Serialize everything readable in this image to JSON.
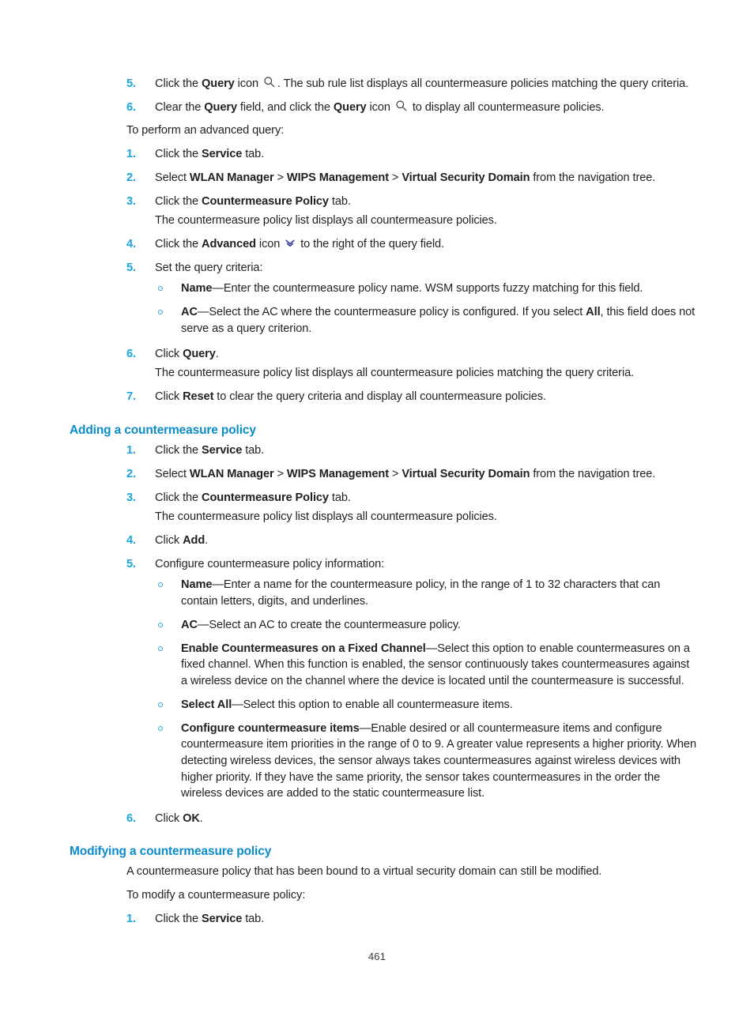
{
  "page": {
    "number": "461",
    "heading_color": "#0c8ccb",
    "list_number_color": "#18a5e0",
    "bullet_color": "#2aa8e0",
    "text_color": "#231f20"
  },
  "icons": {
    "query": "search-icon",
    "advanced": "double-chevron-down-icon"
  },
  "block_query_steps": {
    "items": [
      {
        "num": "5.",
        "pre": "Click the ",
        "bold1": "Query",
        "mid": " icon ",
        "icon": "search-icon",
        "post": ". The sub rule list displays all countermeasure policies matching the query criteria."
      },
      {
        "num": "6.",
        "pre": "Clear the ",
        "bold1": "Query",
        "mid": " field, and click the ",
        "bold2": "Query",
        "mid2": " icon ",
        "icon": "search-icon",
        "post": " to display all countermeasure policies."
      }
    ]
  },
  "advanced_query": {
    "lead": "To perform an advanced query:",
    "steps": [
      {
        "num": "1.",
        "pre": "Click the ",
        "bold": "Service",
        "post": " tab."
      },
      {
        "num": "2.",
        "pre": "Select ",
        "bold1": "WLAN Manager",
        "sep1": " > ",
        "bold2": "WIPS Management",
        "sep2": " > ",
        "bold3": "Virtual Security Domain",
        "post": " from the navigation tree."
      },
      {
        "num": "3.",
        "pre": "Click the ",
        "bold": "Countermeasure Policy",
        "post": " tab.",
        "subpara": "The countermeasure policy list displays all countermeasure policies."
      },
      {
        "num": "4.",
        "pre": "Click the ",
        "bold": "Advanced",
        "mid": " icon ",
        "icon": "double-chevron-down-icon",
        "post": " to the right of the query field."
      },
      {
        "num": "5.",
        "text": "Set the query criteria:",
        "subs": [
          {
            "bold": "Name",
            "dash": "—",
            "text": "Enter the countermeasure policy name. WSM supports fuzzy matching for this field."
          },
          {
            "bold": "AC",
            "dash": "—",
            "text_before": "Select the AC where the countermeasure policy is configured. If you select ",
            "bold_inline": "All",
            "text_after": ", this field does not serve as a query criterion."
          }
        ]
      },
      {
        "num": "6.",
        "pre": "Click ",
        "bold": "Query",
        "post": ".",
        "subpara": "The countermeasure policy list displays all countermeasure policies matching the query criteria."
      },
      {
        "num": "7.",
        "pre": "Click ",
        "bold": "Reset",
        "post": " to clear the query criteria and display all countermeasure policies."
      }
    ]
  },
  "adding_section": {
    "heading": "Adding a countermeasure policy",
    "steps": [
      {
        "num": "1.",
        "pre": "Click the ",
        "bold": "Service",
        "post": " tab."
      },
      {
        "num": "2.",
        "pre": "Select ",
        "bold1": "WLAN Manager",
        "sep1": " > ",
        "bold2": "WIPS Management",
        "sep2": " > ",
        "bold3": "Virtual Security Domain",
        "post": " from the navigation tree."
      },
      {
        "num": "3.",
        "pre": "Click the ",
        "bold": "Countermeasure Policy",
        "post": " tab.",
        "subpara": "The countermeasure policy list displays all countermeasure policies."
      },
      {
        "num": "4.",
        "pre": "Click ",
        "bold": "Add",
        "post": "."
      },
      {
        "num": "5.",
        "text": "Configure countermeasure policy information:",
        "subs": [
          {
            "bold": "Name",
            "dash": "—",
            "text": "Enter a name for the countermeasure policy, in the range of 1 to 32 characters that can contain letters, digits, and underlines."
          },
          {
            "bold": "AC",
            "dash": "—",
            "text": "Select an AC to create the countermeasure policy."
          },
          {
            "bold": "Enable Countermeasures on a Fixed Channel",
            "dash": "—",
            "text": "Select this option to enable countermeasures on a fixed channel. When this function is enabled, the sensor continuously takes countermeasures against a wireless device on the channel where the device is located until the countermeasure is successful."
          },
          {
            "bold": "Select All",
            "dash": "—",
            "text": "Select this option to enable all countermeasure items."
          },
          {
            "bold": "Configure countermeasure items",
            "dash": "—",
            "text": "Enable desired or all countermeasure items and configure countermeasure item priorities in the range of 0 to 9. A greater value represents a higher priority. When detecting wireless devices, the sensor always takes countermeasures against wireless devices with higher priority. If they have the same priority, the sensor takes countermeasures in the order the wireless devices are added to the static countermeasure list."
          }
        ]
      },
      {
        "num": "6.",
        "pre": "Click ",
        "bold": "OK",
        "post": "."
      }
    ]
  },
  "modifying_section": {
    "heading": "Modifying a countermeasure policy",
    "para1": "A countermeasure policy that has been bound to a virtual security domain can still be modified.",
    "para2": "To modify a countermeasure policy:",
    "steps": [
      {
        "num": "1.",
        "pre": "Click the ",
        "bold": "Service",
        "post": " tab."
      }
    ]
  }
}
